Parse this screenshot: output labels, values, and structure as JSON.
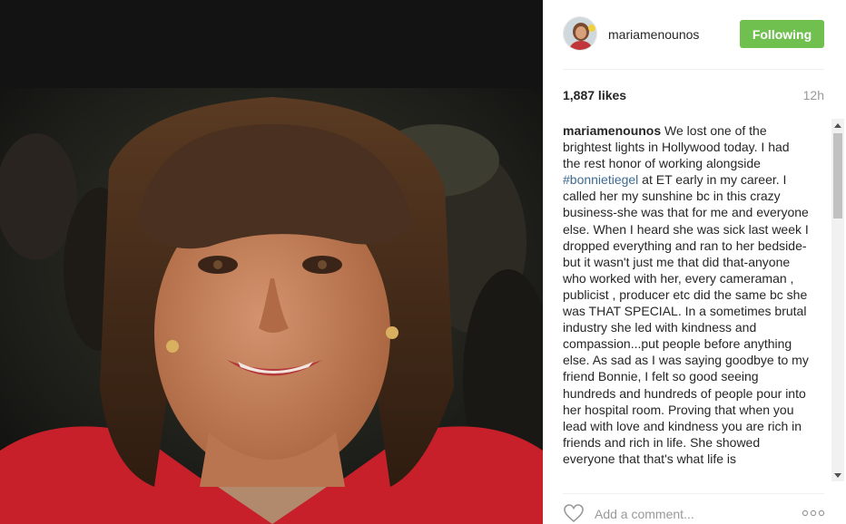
{
  "post": {
    "username": "mariamenounos",
    "follow_label": "Following",
    "likes": "1,887 likes",
    "time": "12h",
    "caption_user": "mariamenounos",
    "caption_part1": " We lost one of the brightest lights in Hollywood today. I had the rest honor of working alongside ",
    "hashtag": "#bonnietiegel",
    "caption_part2": " at ET early in my career. I called her my sunshine bc in this crazy business-she was that for me and everyone else. When I heard she was sick last week I dropped everything and ran to her bedside-but it wasn't just me that did that-anyone who worked with her, every cameraman , publicist , producer etc did the same bc she was THAT SPECIAL. In a sometimes brutal industry she led with kindness and compassion...put people before anything else. As sad as I was saying goodbye to my friend Bonnie, I felt so good seeing hundreds and hundreds of people pour into her hospital room. Proving that when you lead with love and kindness you are rich in friends and rich in life. She showed everyone that that's what life is",
    "comment_placeholder": "Add a comment...",
    "accent_color": "#70c050",
    "hashtag_color": "#3d6a91"
  },
  "icons": {
    "heart": "heart-icon",
    "more": "more-options-icon",
    "scroll_up": "scroll-up-arrow-icon",
    "scroll_down": "scroll-down-arrow-icon"
  }
}
